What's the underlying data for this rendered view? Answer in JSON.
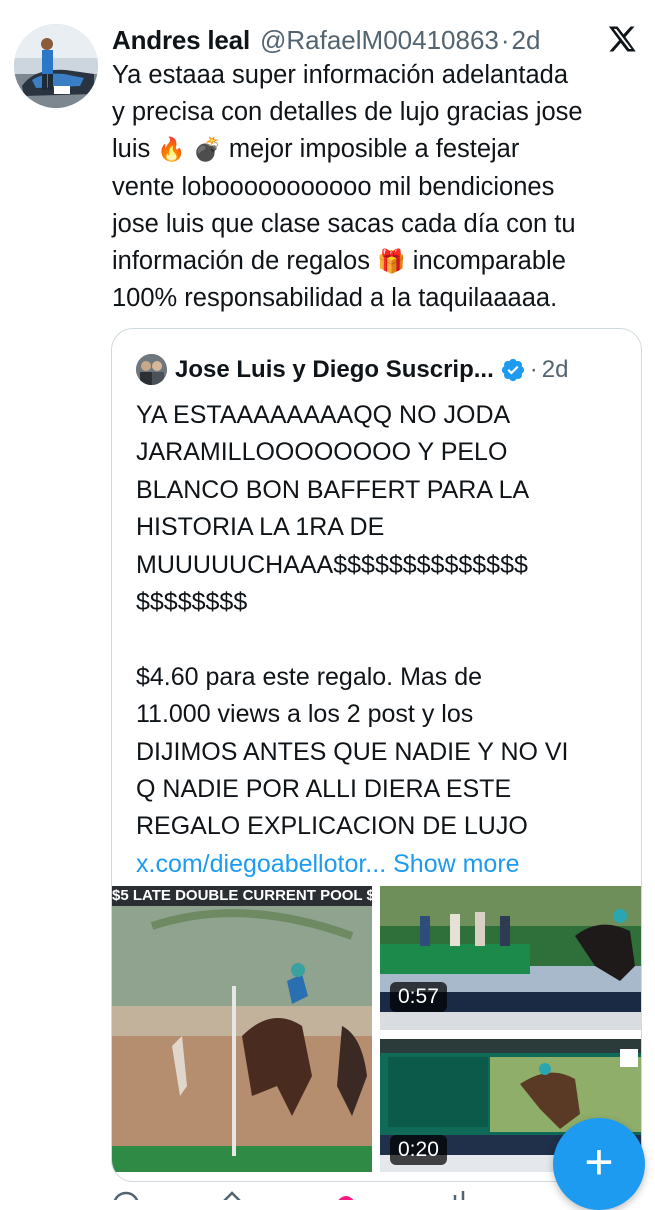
{
  "tweet": {
    "author_name": "Andres leal",
    "handle": "@RafaelM00410863",
    "separator": "·",
    "time": "2d",
    "text_1": "Ya estaaa super información adelantada\ny precisa con detalles de lujo gracias jose\nluis ",
    "emoji_fire": "🔥",
    "emoji_bomb": "💣",
    "text_2": " mejor imposible a festejar\nvente lobooooooooooo mil bendiciones\njose luis que clase sacas cada día con tu\ninformación de regalos ",
    "emoji_gift": "🎁",
    "text_3": " incomparable\n100% responsabilidad  a la taquilaaaaa."
  },
  "quote": {
    "author_name": "Jose Luis y Diego Suscrip...",
    "separator": "·",
    "time": "2d",
    "text": "YA ESTAAAAAAAAQQ NO JODA\nJARAMILLOOOOOOOO Y PELO\nBLANCO BON BAFFERT PARA LA\nHISTORIA LA 1RA DE\nMUUUUUCHAAA$$$$$$$$$$$$$$\n$$$$$$$$\n\n$4.60 para este regalo. Mas de\n11.000 views a los 2 post y los\nDIJIMOS ANTES QUE NADIE Y NO VI\nQ NADIE POR ALLI DIERA ESTE\nREGALO EXPLICACION DE LUJO",
    "link": "x.com/diegoabellotor...",
    "show_more": "Show more",
    "media": [
      {
        "overlay_text": "$5 LATE DOUBLE CURRENT POOL $"
      },
      {
        "duration": "0:57"
      },
      {
        "duration": "0:20"
      }
    ]
  },
  "icons": {
    "x_logo": "x-logo-icon",
    "verified": "verified-badge-icon",
    "compose": "plus-icon"
  },
  "fab_label": "+",
  "colors": {
    "accent": "#1d9bf0",
    "text": "#0f1419",
    "muted": "#536471",
    "border": "#cfd9de"
  }
}
